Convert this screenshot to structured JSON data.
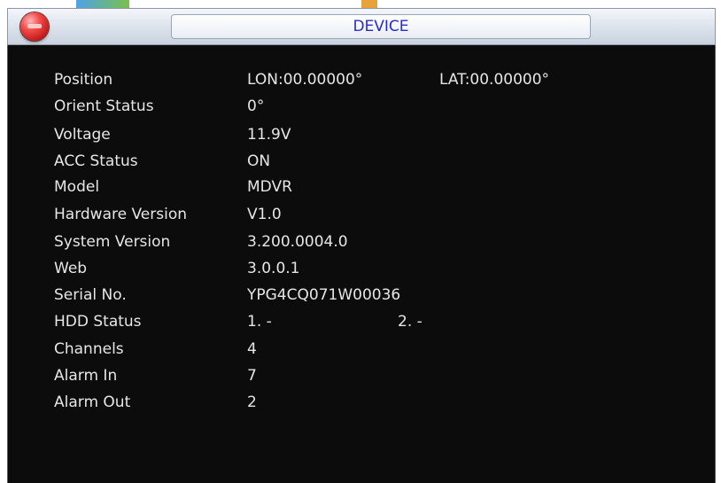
{
  "title": "DEVICE",
  "icons": {
    "close": "close-icon"
  },
  "colors": {
    "title_text": "#2a2ad0",
    "panel_bg": "#0c0c0c",
    "text": "#e6e6e6"
  },
  "fields": {
    "position": {
      "label": "Position",
      "lon": "LON:00.00000°",
      "lat": "LAT:00.00000°"
    },
    "orient_status": {
      "label": "Orient Status",
      "value": "0°"
    },
    "voltage": {
      "label": "Voltage",
      "value": "11.9V"
    },
    "acc_status": {
      "label": "ACC Status",
      "value": "ON"
    },
    "model": {
      "label": "Model",
      "value": "MDVR"
    },
    "hardware_version": {
      "label": "Hardware Version",
      "value": "V1.0"
    },
    "system_version": {
      "label": "System Version",
      "value": "3.200.0004.0"
    },
    "web": {
      "label": "Web",
      "value": "3.0.0.1"
    },
    "serial_no": {
      "label": "Serial No.",
      "value": "YPG4CQ071W00036"
    },
    "hdd_status": {
      "label": "HDD Status",
      "hdd1": "1. -",
      "hdd2": "2. -"
    },
    "channels": {
      "label": "Channels",
      "value": "4"
    },
    "alarm_in": {
      "label": "Alarm In",
      "value": "7"
    },
    "alarm_out": {
      "label": "Alarm Out",
      "value": "2"
    }
  }
}
